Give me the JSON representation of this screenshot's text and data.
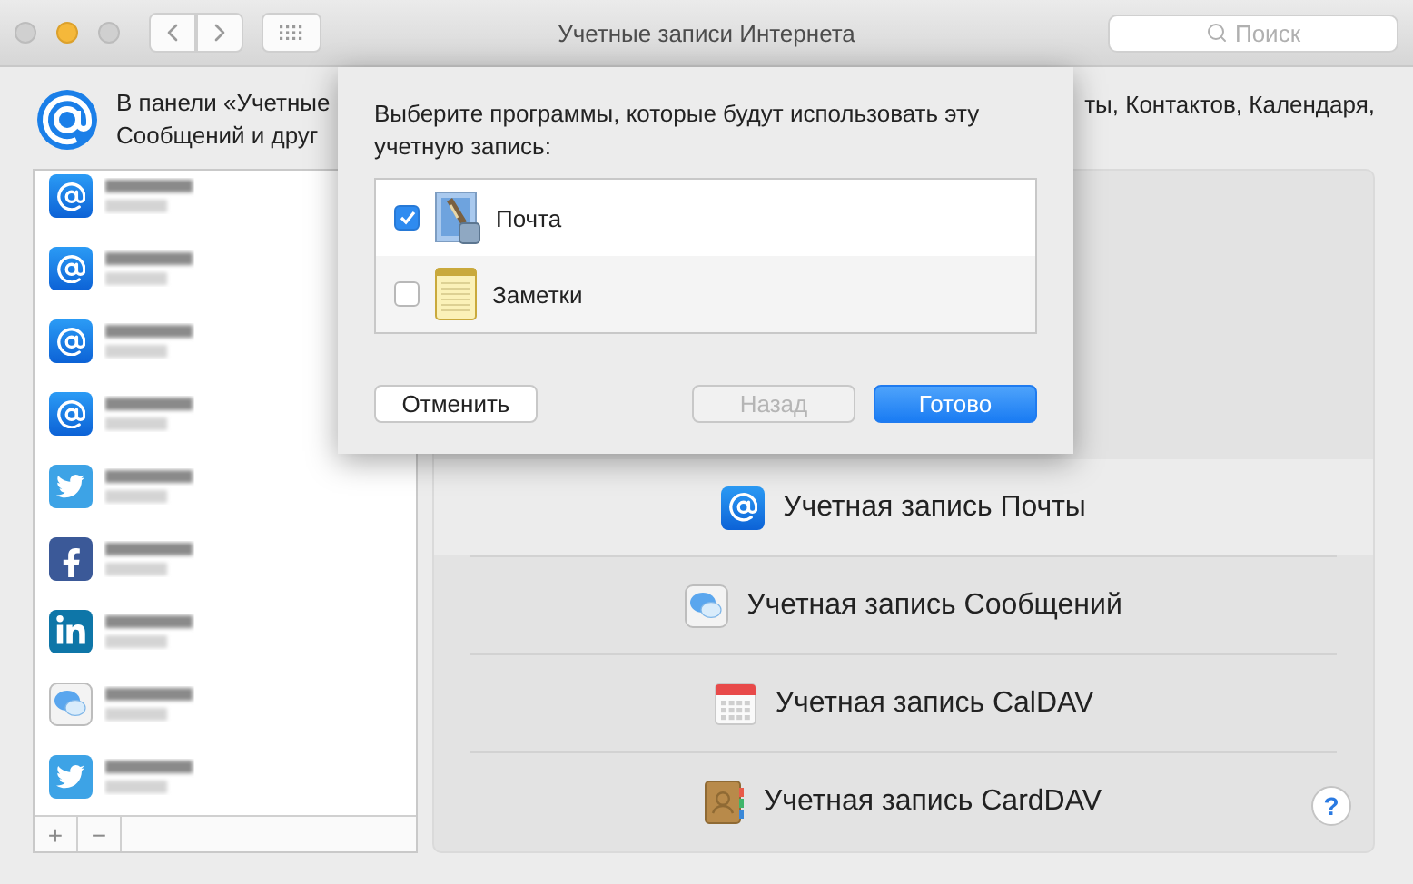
{
  "window": {
    "title": "Учетные записи Интернета"
  },
  "search": {
    "placeholder": "Поиск"
  },
  "intro": {
    "lines_left": [
      "В панели «Учетные",
      "Сообщений и друг"
    ],
    "fragment_right": "ты, Контактов, Календаря,"
  },
  "sidebar": {
    "accounts": [
      {
        "kind": "mail",
        "selected": false
      },
      {
        "kind": "mail",
        "selected": false
      },
      {
        "kind": "mail",
        "selected": false
      },
      {
        "kind": "mail",
        "selected": false
      },
      {
        "kind": "twitter",
        "selected": false
      },
      {
        "kind": "facebook",
        "selected": false
      },
      {
        "kind": "linkedin",
        "selected": false
      },
      {
        "kind": "messages",
        "selected": false
      },
      {
        "kind": "twitter",
        "selected": false
      }
    ],
    "buttons": [
      "+",
      "−"
    ]
  },
  "providers": [
    {
      "kind": "mail",
      "label": "Учетная запись Почты"
    },
    {
      "kind": "messages",
      "label": "Учетная запись Сообщений"
    },
    {
      "kind": "calendar",
      "label": "Учетная запись CalDAV"
    },
    {
      "kind": "contacts",
      "label": "Учетная запись CardDAV"
    }
  ],
  "help": "?",
  "sheet": {
    "prompt": "Выберите программы, которые будут использовать эту учетную запись:",
    "apps": [
      {
        "kind": "mail",
        "name": "Почта",
        "checked": true
      },
      {
        "kind": "notes",
        "name": "Заметки",
        "checked": false
      }
    ],
    "buttons": [
      {
        "label": "Отменить",
        "kind": "default",
        "disabled": false
      },
      {
        "label": "Назад",
        "kind": "default",
        "disabled": true
      },
      {
        "label": "Готово",
        "kind": "primary",
        "disabled": false
      }
    ]
  }
}
